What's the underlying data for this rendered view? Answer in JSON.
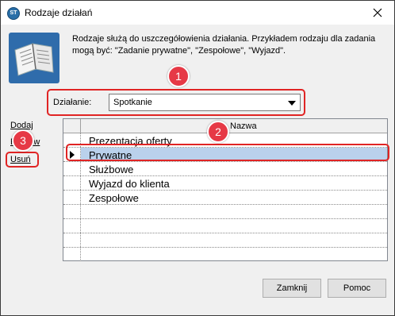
{
  "window": {
    "title": "Rodzaje działań",
    "app_icon_text": "ST"
  },
  "info": {
    "text": "Rodzaje służą do uszczegółowienia działania. Przykładem rodzaju dla zadania mogą być: \"Zadanie prywatne\", \"Zespołowe\", \"Wyjazd\"."
  },
  "form": {
    "label": "Działanie:",
    "selected": "Spotkanie"
  },
  "side_links": {
    "add": "Dodaj",
    "edit": "Popraw",
    "delete": "Usuń"
  },
  "grid": {
    "column": "Nazwa",
    "rows": [
      "Prezentacja oferty",
      "Prywatne",
      "Służbowe",
      "Wyjazd do klienta",
      "Zespołowe"
    ],
    "selected_row": "Prywatne"
  },
  "buttons": {
    "close": "Zamknij",
    "help": "Pomoc"
  },
  "annotations": {
    "one": "1",
    "two": "2",
    "three": "3"
  },
  "colors": {
    "callout": "#e02424",
    "badge": "#e63946",
    "selection": "#bad1ec",
    "icon_bg": "#2f6cab"
  }
}
